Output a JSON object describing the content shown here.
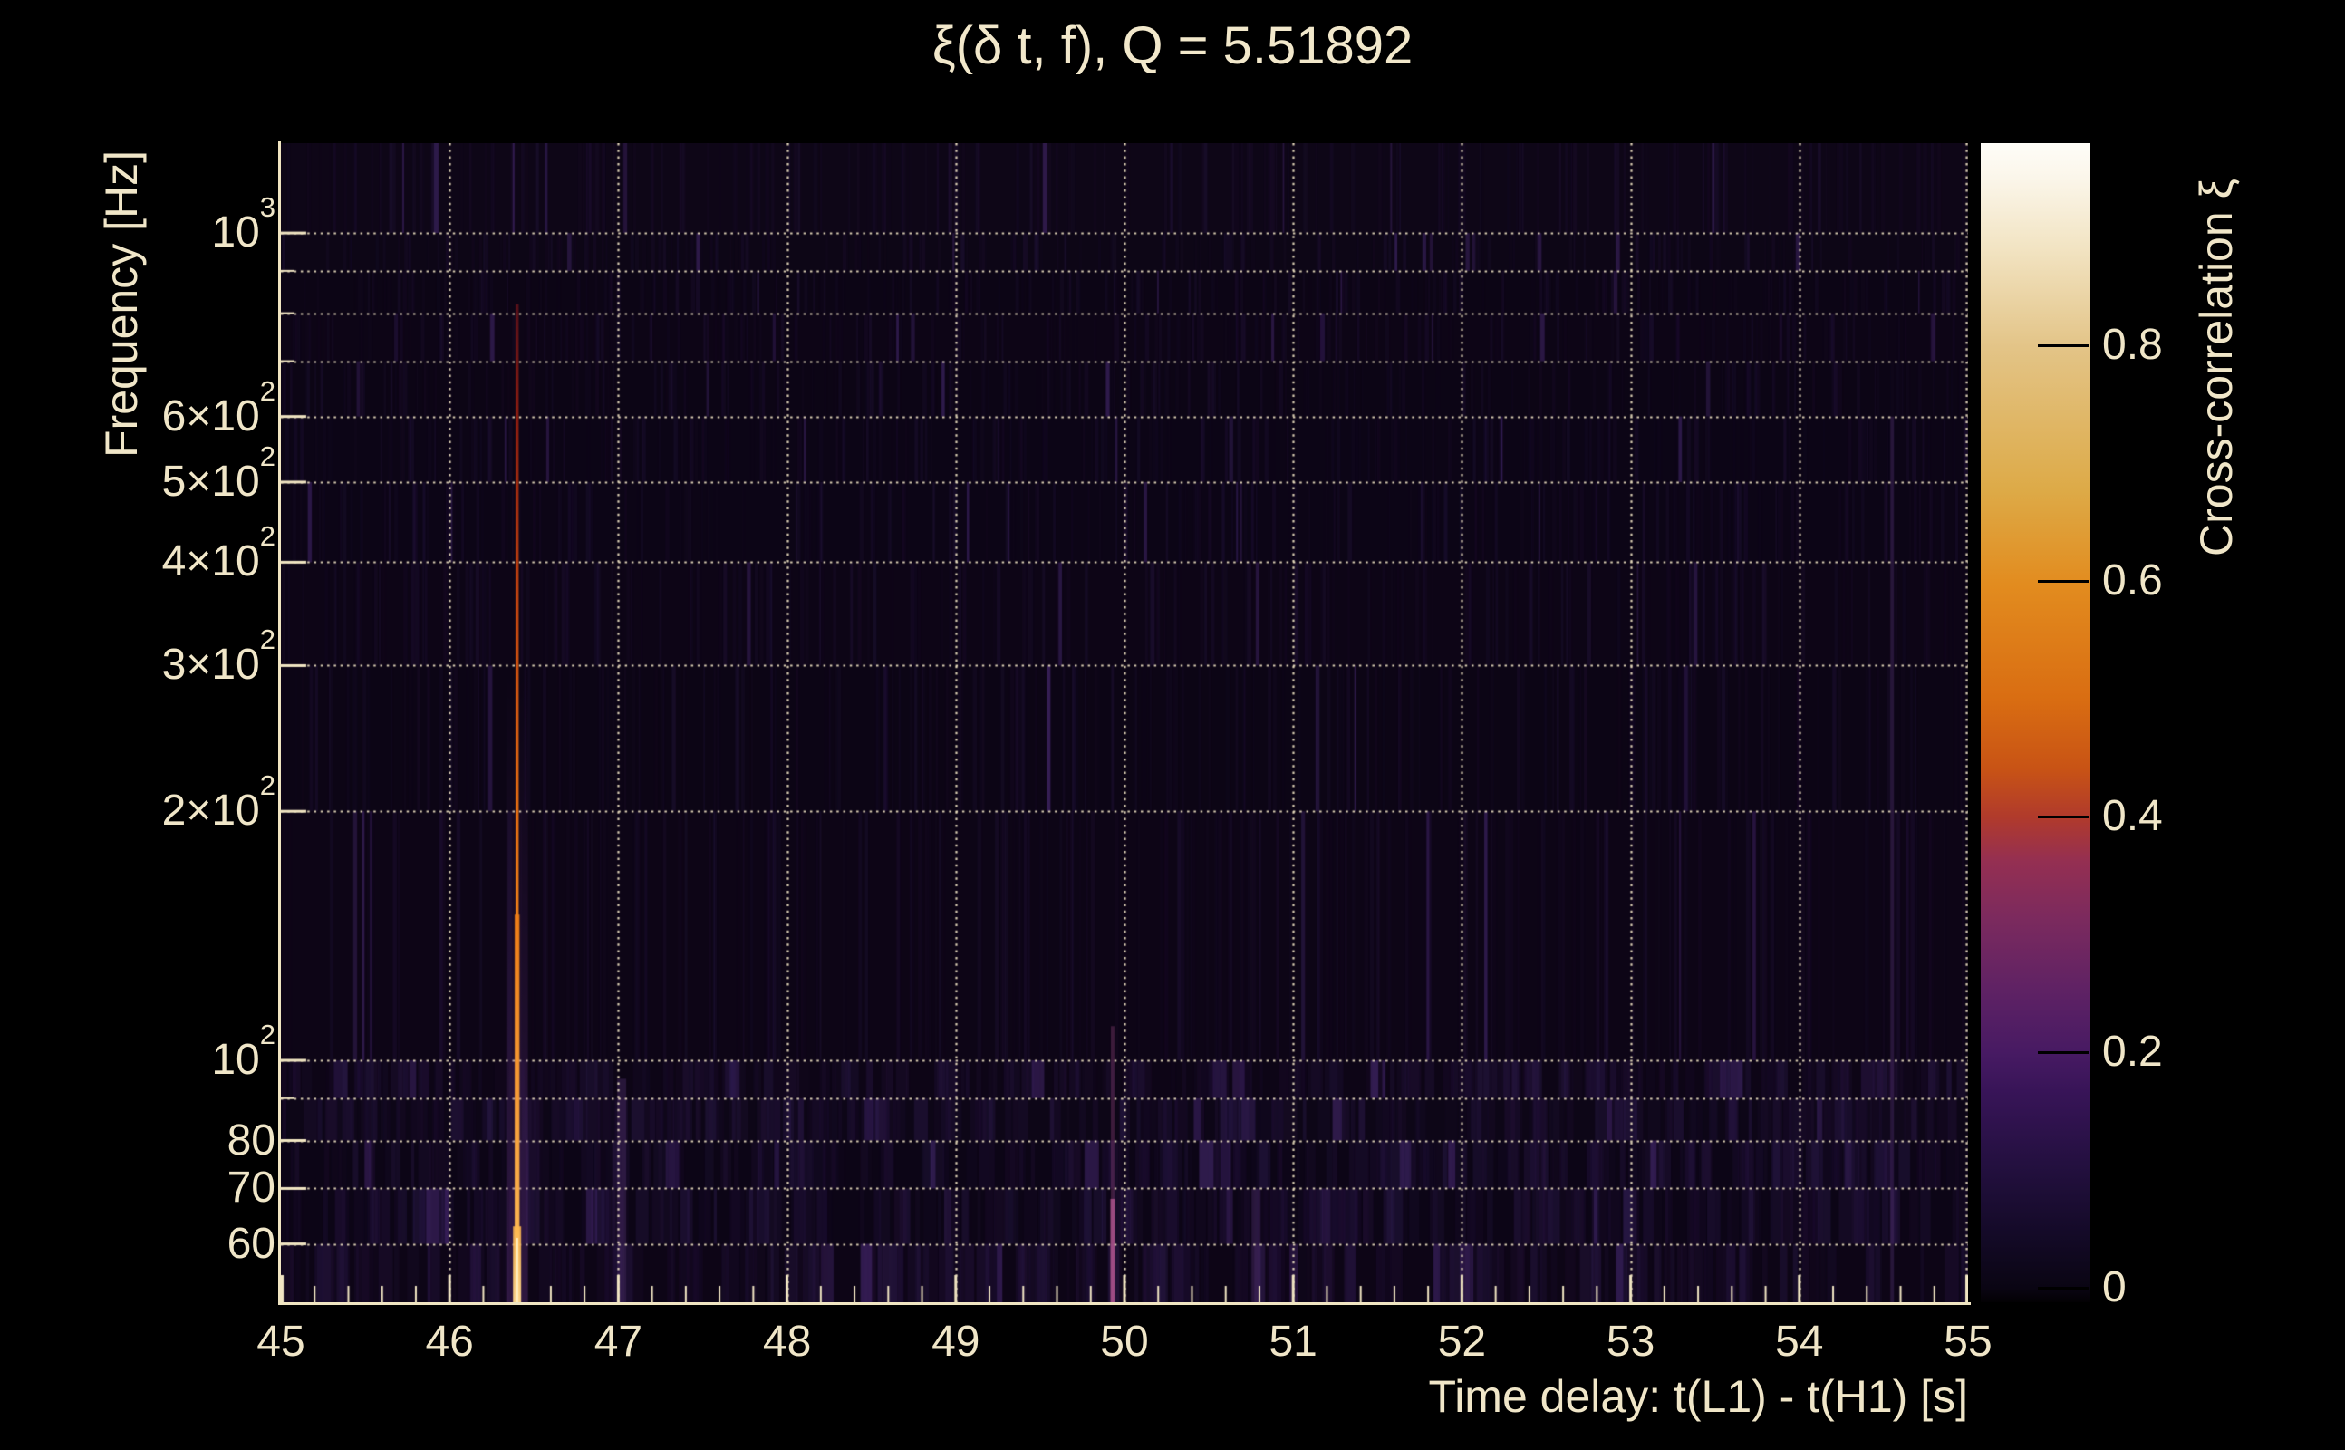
{
  "title": "ξ(δ t, f), Q = 5.51892",
  "chart_data": {
    "type": "heatmap",
    "title": "ξ(δ t, f), Q = 5.51892",
    "q_value": "5.51892",
    "xlabel": "Time delay: t(L1) - t(H1) [s]",
    "ylabel": "Frequency [Hz]",
    "zlabel": "Cross-correlation ξ",
    "xlim": [
      45,
      55
    ],
    "ylim_hz": [
      51,
      1284
    ],
    "y_scale": "log",
    "zlim": [
      -0.0123,
      0.9715
    ],
    "grid": true,
    "x_ticks": [
      {
        "v": 45,
        "label": "45"
      },
      {
        "v": 46,
        "label": "46"
      },
      {
        "v": 47,
        "label": "47"
      },
      {
        "v": 48,
        "label": "48"
      },
      {
        "v": 49,
        "label": "49"
      },
      {
        "v": 50,
        "label": "50"
      },
      {
        "v": 51,
        "label": "51"
      },
      {
        "v": 52,
        "label": "52"
      },
      {
        "v": 53,
        "label": "53"
      },
      {
        "v": 54,
        "label": "54"
      },
      {
        "v": 55,
        "label": "55"
      }
    ],
    "x_minor_step": 0.2,
    "x_gridlines": [
      46,
      47,
      48,
      49,
      50,
      51,
      52,
      53,
      54,
      55
    ],
    "y_ticks": [
      {
        "hz": 1000,
        "base": "10",
        "sup": "3"
      },
      {
        "hz": 600,
        "base": "6×10",
        "sup": "2"
      },
      {
        "hz": 500,
        "base": "5×10",
        "sup": "2"
      },
      {
        "hz": 400,
        "base": "4×10",
        "sup": "2"
      },
      {
        "hz": 300,
        "base": "3×10",
        "sup": "2"
      },
      {
        "hz": 200,
        "base": "2×10",
        "sup": "2"
      },
      {
        "hz": 100,
        "base": "10",
        "sup": "2"
      },
      {
        "hz": 80,
        "base": "80",
        "sup": ""
      },
      {
        "hz": 70,
        "base": "70",
        "sup": ""
      },
      {
        "hz": 60,
        "base": "60",
        "sup": ""
      }
    ],
    "y_gridlines_hz": [
      60,
      70,
      80,
      90,
      100,
      200,
      300,
      400,
      500,
      600,
      700,
      800,
      900,
      1000
    ],
    "y_minor_ticks_hz": [
      90,
      700,
      800,
      900
    ],
    "z_ticks": [
      {
        "v": 0.8,
        "label": "0.8"
      },
      {
        "v": 0.6,
        "label": "0.6"
      },
      {
        "v": 0.4,
        "label": "0.4"
      },
      {
        "v": 0.2,
        "label": "0.2"
      },
      {
        "v": 0,
        "label": "0"
      }
    ],
    "main_feature": {
      "t": 46.4,
      "f_top_hz": 820,
      "description": "bright orange cross-correlation ridge spanning full frequency band"
    },
    "secondary_features": [
      {
        "t": 49.93,
        "f_top_hz": 110,
        "tint": "magenta",
        "description": "faint pink streak at low frequency"
      },
      {
        "t": 50.78,
        "f_top_hz": 70,
        "tint": "purple",
        "description": "broad faint purple column near bottom"
      },
      {
        "t": 47.02,
        "f_top_hz": 95,
        "tint": "purple",
        "description": "thin purple streak near bottom"
      },
      {
        "t": 54.55,
        "f_top_hz": 600,
        "tint": "purple",
        "description": "tall faint purple streak"
      }
    ],
    "colors": {
      "background": "#000000",
      "plot_background": "#0d0616",
      "text": "#f2e8cb",
      "grid": "#f2e5c4",
      "spine": "#f0e5c2",
      "noise_streaks": [
        "#1d0d31",
        "#241239",
        "#2a1747",
        "#332057",
        "#46296f"
      ],
      "colorbar_stops": [
        {
          "p": 0.0,
          "c": "#030104"
        },
        {
          "p": 0.012,
          "c": "#0a0513"
        },
        {
          "p": 0.06,
          "c": "#140a28"
        },
        {
          "p": 0.12,
          "c": "#241040"
        },
        {
          "p": 0.18,
          "c": "#371457"
        },
        {
          "p": 0.215,
          "c": "#471a63"
        },
        {
          "p": 0.27,
          "c": "#5f2264"
        },
        {
          "p": 0.33,
          "c": "#7b2a5e"
        },
        {
          "p": 0.38,
          "c": "#942f52"
        },
        {
          "p": 0.418,
          "c": "#b03a2c"
        },
        {
          "p": 0.46,
          "c": "#c85315"
        },
        {
          "p": 0.52,
          "c": "#d96d12"
        },
        {
          "p": 0.62,
          "c": "#e28c1f"
        },
        {
          "p": 0.7,
          "c": "#ddaa47"
        },
        {
          "p": 0.824,
          "c": "#e3c487"
        },
        {
          "p": 0.91,
          "c": "#f2e4c3"
        },
        {
          "p": 0.97,
          "c": "#fbf6ea"
        },
        {
          "p": 1.0,
          "c": "#fefdf8"
        }
      ],
      "ridge_stops": [
        {
          "p": 0.0,
          "c": "#55101a"
        },
        {
          "p": 0.12,
          "c": "#8c1d10"
        },
        {
          "p": 0.3,
          "c": "#c04410"
        },
        {
          "p": 0.5,
          "c": "#e06a12"
        },
        {
          "p": 0.7,
          "c": "#f28c1e"
        },
        {
          "p": 0.85,
          "c": "#f9a534"
        },
        {
          "p": 1.0,
          "c": "#ffc866"
        }
      ]
    }
  }
}
